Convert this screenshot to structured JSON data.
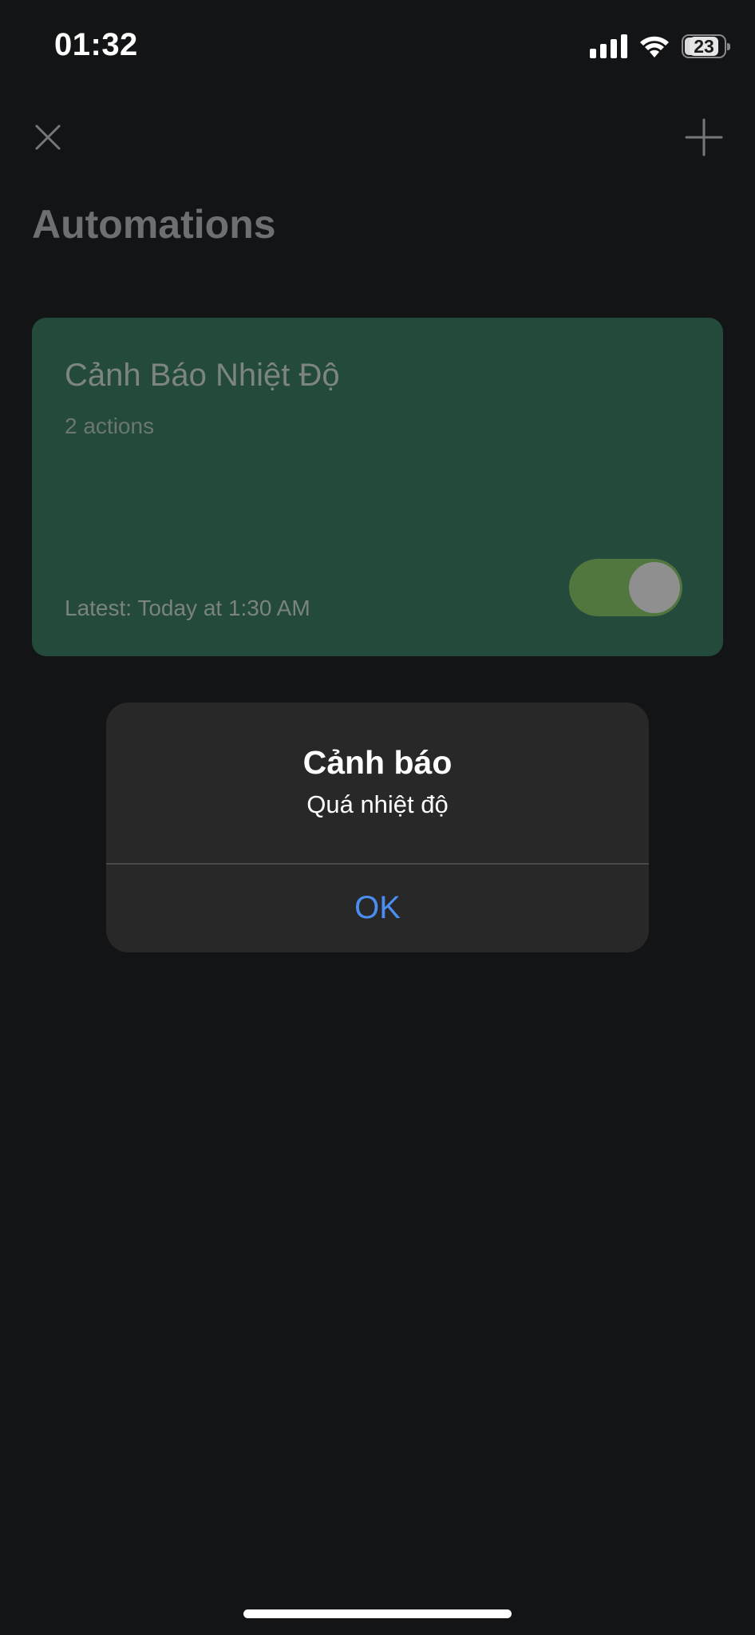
{
  "status_bar": {
    "time": "01:32",
    "battery_level": "23",
    "icons": [
      "signal-icon",
      "wifi-icon",
      "battery-icon"
    ]
  },
  "nav": {
    "close_icon": "close-icon",
    "add_icon": "plus-icon"
  },
  "page": {
    "title": "Automations"
  },
  "automation_card": {
    "title": "Cảnh Báo Nhiệt Độ",
    "subtitle": "2 actions",
    "latest": "Latest: Today at 1:30 AM",
    "enabled": true,
    "color": "#234a3a"
  },
  "alert": {
    "title": "Cảnh báo",
    "message": "Quá nhiệt độ",
    "ok_label": "OK",
    "accent_color": "#4a8ef0"
  }
}
